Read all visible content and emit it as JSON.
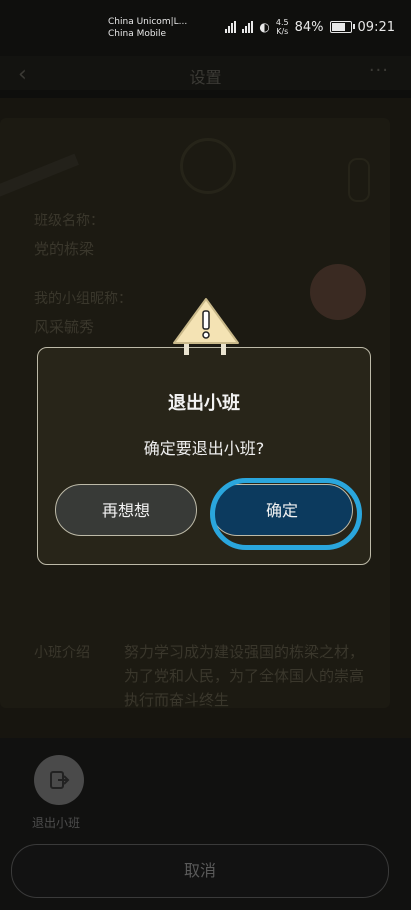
{
  "status": {
    "carrier1": "China Unicom|L...",
    "carrier2": "China Mobile",
    "net_speed_value": "4.5",
    "net_speed_unit": "K/s",
    "battery": "84%",
    "time": "09:21"
  },
  "header": {
    "title": "设置"
  },
  "background": {
    "class_name_label": "班级名称：",
    "class_name_value": "党的栋梁",
    "my_group_label": "我的小组昵称：",
    "my_group_value": "风采毓秀",
    "intro_label": "小班介绍",
    "intro_text": "努力学习成为建设强国的栋梁之材，为了党和人民，为了全体国人的崇高执行而奋斗终生"
  },
  "sheet": {
    "exit_label": "退出小班",
    "cancel_label": "取消"
  },
  "dialog": {
    "title": "退出小班",
    "message": "确定要退出小班?",
    "cancel_label": "再想想",
    "confirm_label": "确定"
  },
  "colors": {
    "dialog_bg": "#282519",
    "confirm_bg": "#0c3a5e",
    "highlight": "#2aa6dd",
    "warning": "#f4e3b4"
  }
}
